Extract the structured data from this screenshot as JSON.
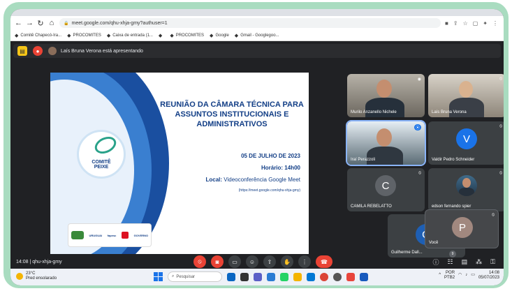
{
  "browser": {
    "url": "meet.google.com/qhu-xhja-gmy?authuser=1",
    "bookmarks": [
      {
        "label": "Comitê Chapecó-Ira...",
        "icon": "comite-icon"
      },
      {
        "label": "PROCOMITES",
        "icon": "procomites-icon"
      },
      {
        "label": "Caixa de entrada (1...",
        "icon": "gmail-icon"
      },
      {
        "label": "",
        "icon": "chrome-icon"
      },
      {
        "label": "PROCOMITES",
        "icon": "procomites-icon"
      },
      {
        "label": "Google",
        "icon": "google-icon"
      },
      {
        "label": "Gmail - Googlegoo...",
        "icon": "gmail-icon"
      }
    ]
  },
  "meet": {
    "presenting_text": "Laís Bruna Verona está apresentando",
    "time": "14:08",
    "meeting_code": "qhu-xhja-gmy",
    "participant_badge": "9"
  },
  "slide": {
    "title": "REUNIÃO DA CÂMARA TÉCNICA PARA ASSUNTOS INSTITUCIONAIS E ADMINISTRATIVOS",
    "logo_line1": "COMITÊ",
    "logo_line2": "PEIXE",
    "date": "05 DE JULHO DE 2023",
    "hour": "Horário: 14h00",
    "location_label": "Local:",
    "location_value": "Videoconferência Google Meet",
    "link": "(https://meet.google.com/qhu-xhja-gmy)",
    "footer_logos": [
      "URUGUAI",
      "fapesc",
      "GOVERNO"
    ]
  },
  "participants": [
    {
      "name": "Murilo Anzanello Nichele",
      "initial": ""
    },
    {
      "name": "Laís Bruna Verona",
      "initial": ""
    },
    {
      "name": "Iraí Perazzoli",
      "initial": ""
    },
    {
      "name": "Valdir Pedro Schneider",
      "initial": "V"
    },
    {
      "name": "CAMILA REBELATTO",
      "initial": "C"
    },
    {
      "name": "edson fernando spier",
      "initial": ""
    },
    {
      "name": "Guilherme Dall...",
      "initial": "G"
    },
    {
      "name": "Você",
      "initial": "P"
    }
  ],
  "colors": {
    "avatar_v": "#1a73e8",
    "avatar_c": "#5f6368",
    "avatar_p": "#a1887f",
    "avatar_g": "#1e5fb4",
    "end_call": "#ea4335"
  },
  "taskbar": {
    "temp": "23°C",
    "weather_desc": "Pred ensolarado",
    "search_placeholder": "Pesquisar",
    "lang_line1": "POR",
    "lang_line2": "PTB2",
    "clock_time": "14:08",
    "clock_date": "05/07/2023"
  }
}
